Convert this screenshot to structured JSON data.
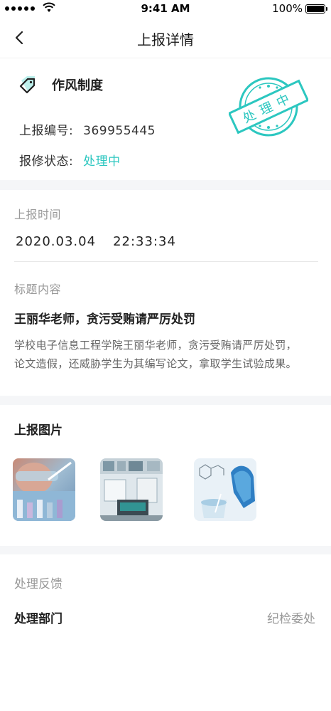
{
  "status_bar": {
    "time": "9:41 AM",
    "battery_text": "100%"
  },
  "nav": {
    "title": "上报详情",
    "back_icon": "chevron-left-icon"
  },
  "report": {
    "category_icon": "tag-icon",
    "category": "作风制度",
    "number_label": "上报编号:",
    "number_value": "369955445",
    "status_label": "报修状态:",
    "status_value": "处理中",
    "stamp_text": "处理中",
    "accent_color": "#2cc7c0"
  },
  "time_section": {
    "label": "上报时间",
    "date": "2020.03.04",
    "time": "22:33:34"
  },
  "content_section": {
    "label": "标题内容",
    "title": "王丽华老师，贪污受贿请严厉处罚",
    "body": "学校电子信息工程学院王丽华老师，贪污受贿请严厉处罚，论文造假，还威胁学生为其编写论文，拿取学生试验成果。"
  },
  "images_section": {
    "title": "上报图片"
  },
  "feedback_section": {
    "label": "处理反馈",
    "dept_label": "处理部门",
    "dept_value": "纪检委处"
  }
}
